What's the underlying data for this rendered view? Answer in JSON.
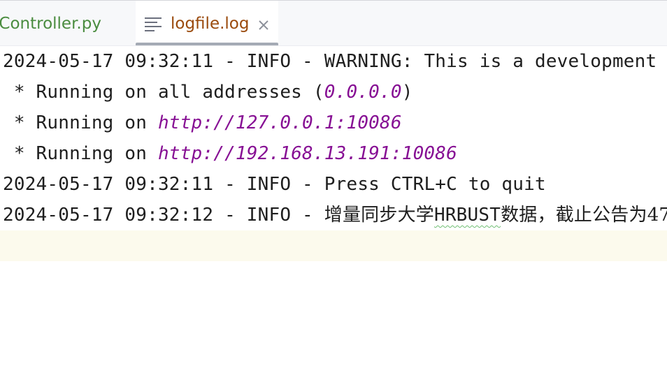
{
  "tabs": [
    {
      "label": "lController.py",
      "active": false
    },
    {
      "label": "logfile.log",
      "active": true,
      "icon": "text-lines-icon",
      "close_icon": "close-icon"
    }
  ],
  "log": {
    "line1": {
      "timestamp": "2024-05-17 09:32:11",
      "sep1": " - ",
      "level": "INFO",
      "sep2": " - ",
      "message": "WARNING: This is a development"
    },
    "line2": {
      "prefix": " * Running on all addresses (",
      "address": "0.0.0.0",
      "suffix": ")"
    },
    "line3": {
      "prefix": " * Running on ",
      "url": "http://127.0.0.1:10086"
    },
    "line4": {
      "prefix": " * Running on ",
      "url": "http://192.168.13.191:10086"
    },
    "line5": {
      "timestamp": "2024-05-17 09:32:11",
      "sep1": " - ",
      "level": "INFO",
      "sep2": " - ",
      "message": "Press CTRL+C to quit"
    },
    "line6": {
      "timestamp": "2024-05-17 09:32:12",
      "sep1": " - ",
      "level": "INFO",
      "sep2": " - ",
      "msg_a": "增量同步大学",
      "msg_b": "HRBUST",
      "msg_c": "数据，截止公告为47"
    }
  },
  "colors": {
    "tab_inactive_text": "#4a8c3f",
    "tab_active_text": "#9a4a0c",
    "link": "#871094",
    "caret_row": "#fcfaed"
  }
}
